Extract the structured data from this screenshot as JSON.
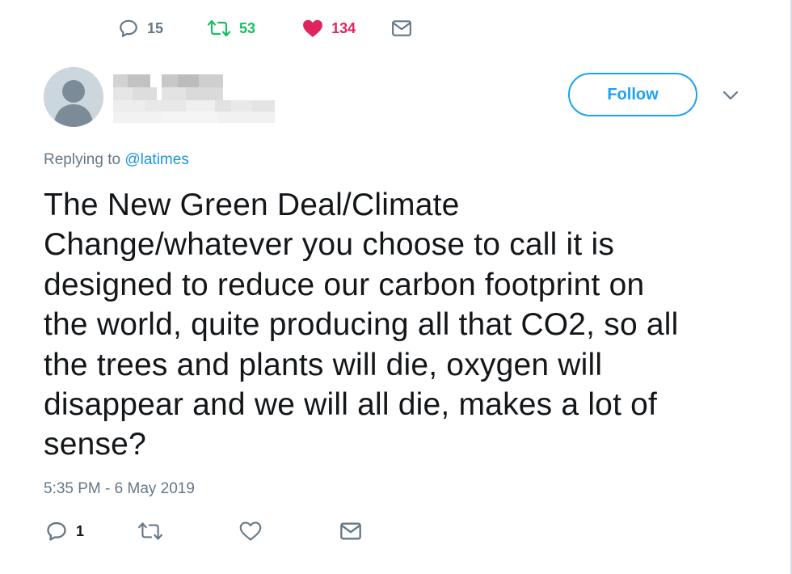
{
  "top_actions": {
    "reply_count": "15",
    "retweet_count": "53",
    "like_count": "134"
  },
  "header": {
    "follow_label": "Follow"
  },
  "reply_context": {
    "prefix": "Replying to",
    "handle": "@latimes"
  },
  "tweet": {
    "lines": [
      "The New Green Deal/Climate",
      "Change/whatever you choose to call it is",
      "designed to reduce our carbon footprint on",
      "the world, quite producing all that CO2, so all",
      "the trees and plants will die, oxygen will",
      "disappear and we will all die, makes a lot of",
      "sense?"
    ],
    "timestamp": "5:35 PM - 6 May 2019"
  },
  "bottom_actions": {
    "reply_count": "1"
  },
  "icons": {
    "reply": "reply-icon",
    "retweet": "retweet-icon",
    "like": "heart-icon",
    "message": "envelope-icon",
    "chevron": "chevron-down-icon"
  },
  "colors": {
    "accent": "#1da1f2",
    "retweet": "#17bf63",
    "like": "#e0245e",
    "muted": "#657786",
    "text": "#14171a"
  }
}
